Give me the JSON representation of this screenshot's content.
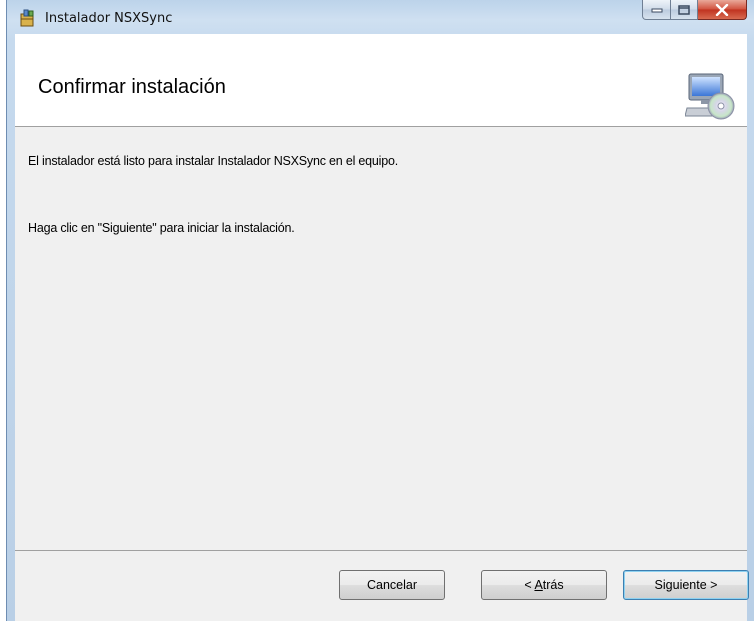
{
  "window": {
    "title": "Instalador NSXSync",
    "icon": "installer-icon",
    "controls": {
      "minimize": "minimize-icon",
      "maximize": "maximize-icon",
      "close": "close-icon"
    }
  },
  "banner": {
    "title": "Confirmar instalación",
    "graphic": "computer-disc-icon"
  },
  "content": {
    "line1": "El instalador está listo para instalar Instalador NSXSync en el equipo.",
    "line2": "Haga clic en \"Siguiente\" para iniciar la instalación."
  },
  "buttons": {
    "cancel": "Cancelar",
    "back_prefix": "< ",
    "back_mnemonic": "A",
    "back_rest": "trás",
    "next": "Siguiente >"
  },
  "colors": {
    "close_button": "#c0321f",
    "default_button_border": "#3c7fb1"
  }
}
